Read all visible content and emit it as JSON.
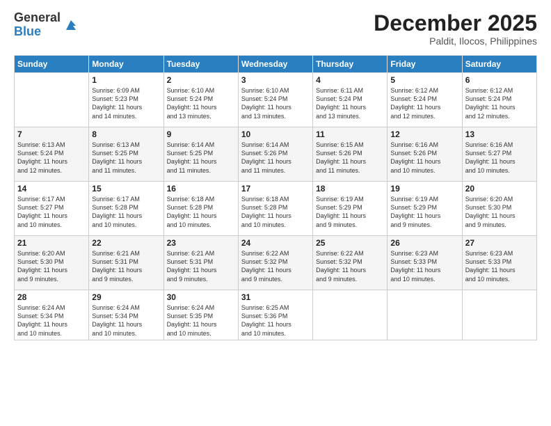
{
  "logo": {
    "general": "General",
    "blue": "Blue"
  },
  "header": {
    "month": "December 2025",
    "location": "Paldit, Ilocos, Philippines"
  },
  "days_of_week": [
    "Sunday",
    "Monday",
    "Tuesday",
    "Wednesday",
    "Thursday",
    "Friday",
    "Saturday"
  ],
  "weeks": [
    [
      {
        "day": "",
        "info": ""
      },
      {
        "day": "1",
        "info": "Sunrise: 6:09 AM\nSunset: 5:23 PM\nDaylight: 11 hours\nand 14 minutes."
      },
      {
        "day": "2",
        "info": "Sunrise: 6:10 AM\nSunset: 5:24 PM\nDaylight: 11 hours\nand 13 minutes."
      },
      {
        "day": "3",
        "info": "Sunrise: 6:10 AM\nSunset: 5:24 PM\nDaylight: 11 hours\nand 13 minutes."
      },
      {
        "day": "4",
        "info": "Sunrise: 6:11 AM\nSunset: 5:24 PM\nDaylight: 11 hours\nand 13 minutes."
      },
      {
        "day": "5",
        "info": "Sunrise: 6:12 AM\nSunset: 5:24 PM\nDaylight: 11 hours\nand 12 minutes."
      },
      {
        "day": "6",
        "info": "Sunrise: 6:12 AM\nSunset: 5:24 PM\nDaylight: 11 hours\nand 12 minutes."
      }
    ],
    [
      {
        "day": "7",
        "info": "Sunrise: 6:13 AM\nSunset: 5:24 PM\nDaylight: 11 hours\nand 12 minutes."
      },
      {
        "day": "8",
        "info": "Sunrise: 6:13 AM\nSunset: 5:25 PM\nDaylight: 11 hours\nand 11 minutes."
      },
      {
        "day": "9",
        "info": "Sunrise: 6:14 AM\nSunset: 5:25 PM\nDaylight: 11 hours\nand 11 minutes."
      },
      {
        "day": "10",
        "info": "Sunrise: 6:14 AM\nSunset: 5:26 PM\nDaylight: 11 hours\nand 11 minutes."
      },
      {
        "day": "11",
        "info": "Sunrise: 6:15 AM\nSunset: 5:26 PM\nDaylight: 11 hours\nand 11 minutes."
      },
      {
        "day": "12",
        "info": "Sunrise: 6:16 AM\nSunset: 5:26 PM\nDaylight: 11 hours\nand 10 minutes."
      },
      {
        "day": "13",
        "info": "Sunrise: 6:16 AM\nSunset: 5:27 PM\nDaylight: 11 hours\nand 10 minutes."
      }
    ],
    [
      {
        "day": "14",
        "info": "Sunrise: 6:17 AM\nSunset: 5:27 PM\nDaylight: 11 hours\nand 10 minutes."
      },
      {
        "day": "15",
        "info": "Sunrise: 6:17 AM\nSunset: 5:28 PM\nDaylight: 11 hours\nand 10 minutes."
      },
      {
        "day": "16",
        "info": "Sunrise: 6:18 AM\nSunset: 5:28 PM\nDaylight: 11 hours\nand 10 minutes."
      },
      {
        "day": "17",
        "info": "Sunrise: 6:18 AM\nSunset: 5:28 PM\nDaylight: 11 hours\nand 10 minutes."
      },
      {
        "day": "18",
        "info": "Sunrise: 6:19 AM\nSunset: 5:29 PM\nDaylight: 11 hours\nand 9 minutes."
      },
      {
        "day": "19",
        "info": "Sunrise: 6:19 AM\nSunset: 5:29 PM\nDaylight: 11 hours\nand 9 minutes."
      },
      {
        "day": "20",
        "info": "Sunrise: 6:20 AM\nSunset: 5:30 PM\nDaylight: 11 hours\nand 9 minutes."
      }
    ],
    [
      {
        "day": "21",
        "info": "Sunrise: 6:20 AM\nSunset: 5:30 PM\nDaylight: 11 hours\nand 9 minutes."
      },
      {
        "day": "22",
        "info": "Sunrise: 6:21 AM\nSunset: 5:31 PM\nDaylight: 11 hours\nand 9 minutes."
      },
      {
        "day": "23",
        "info": "Sunrise: 6:21 AM\nSunset: 5:31 PM\nDaylight: 11 hours\nand 9 minutes."
      },
      {
        "day": "24",
        "info": "Sunrise: 6:22 AM\nSunset: 5:32 PM\nDaylight: 11 hours\nand 9 minutes."
      },
      {
        "day": "25",
        "info": "Sunrise: 6:22 AM\nSunset: 5:32 PM\nDaylight: 11 hours\nand 9 minutes."
      },
      {
        "day": "26",
        "info": "Sunrise: 6:23 AM\nSunset: 5:33 PM\nDaylight: 11 hours\nand 10 minutes."
      },
      {
        "day": "27",
        "info": "Sunrise: 6:23 AM\nSunset: 5:33 PM\nDaylight: 11 hours\nand 10 minutes."
      }
    ],
    [
      {
        "day": "28",
        "info": "Sunrise: 6:24 AM\nSunset: 5:34 PM\nDaylight: 11 hours\nand 10 minutes."
      },
      {
        "day": "29",
        "info": "Sunrise: 6:24 AM\nSunset: 5:34 PM\nDaylight: 11 hours\nand 10 minutes."
      },
      {
        "day": "30",
        "info": "Sunrise: 6:24 AM\nSunset: 5:35 PM\nDaylight: 11 hours\nand 10 minutes."
      },
      {
        "day": "31",
        "info": "Sunrise: 6:25 AM\nSunset: 5:36 PM\nDaylight: 11 hours\nand 10 minutes."
      },
      {
        "day": "",
        "info": ""
      },
      {
        "day": "",
        "info": ""
      },
      {
        "day": "",
        "info": ""
      }
    ]
  ]
}
